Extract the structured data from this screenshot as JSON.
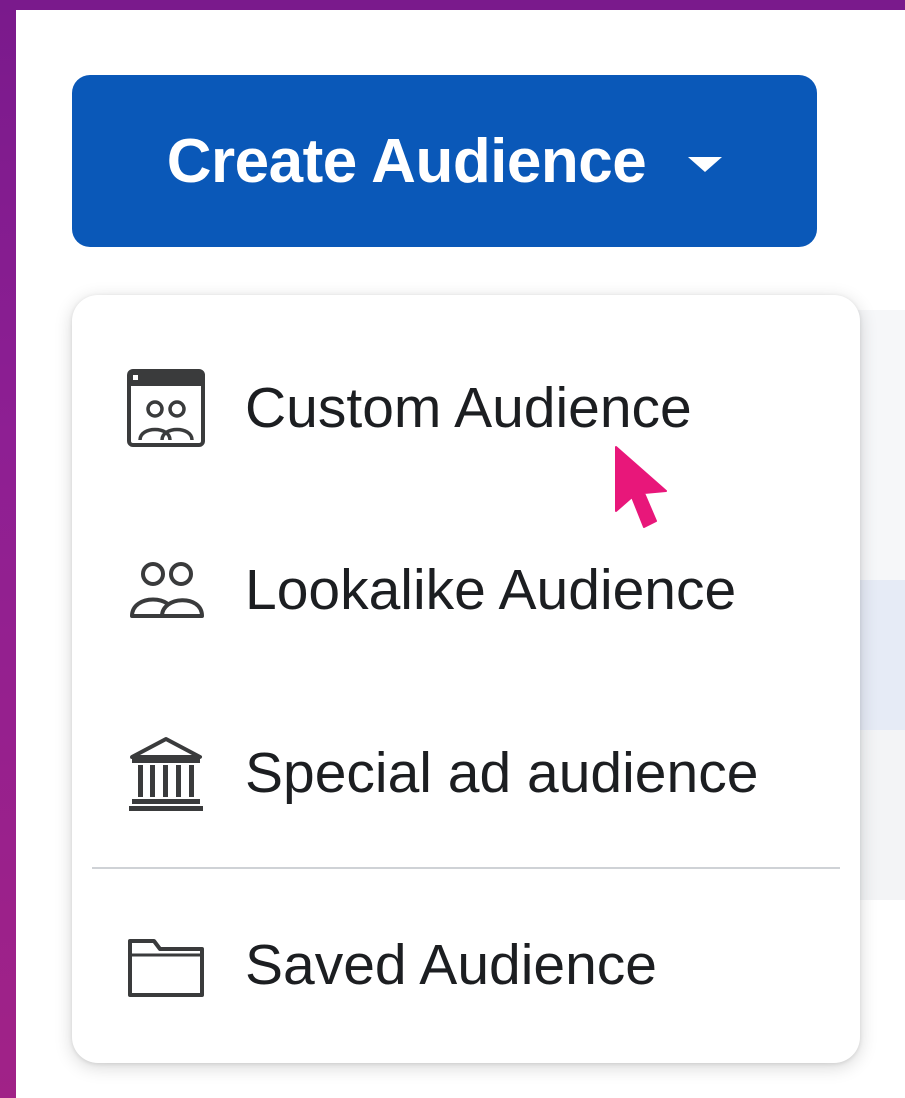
{
  "create_button": {
    "label": "Create Audience",
    "caret_icon": "caret-down-icon",
    "color": "#0a58b8"
  },
  "menu": {
    "items": [
      {
        "label": "Custom Audience",
        "icon": "custom-audience-icon"
      },
      {
        "label": "Lookalike Audience",
        "icon": "people-icon"
      },
      {
        "label": "Special ad audience",
        "icon": "bank-building-icon"
      },
      {
        "label": "Saved Audience",
        "icon": "folder-icon"
      }
    ]
  },
  "cursor": {
    "icon": "pointer-cursor-icon",
    "color": "#e8177a"
  },
  "background": {
    "frame_color": "#8e1f93"
  }
}
